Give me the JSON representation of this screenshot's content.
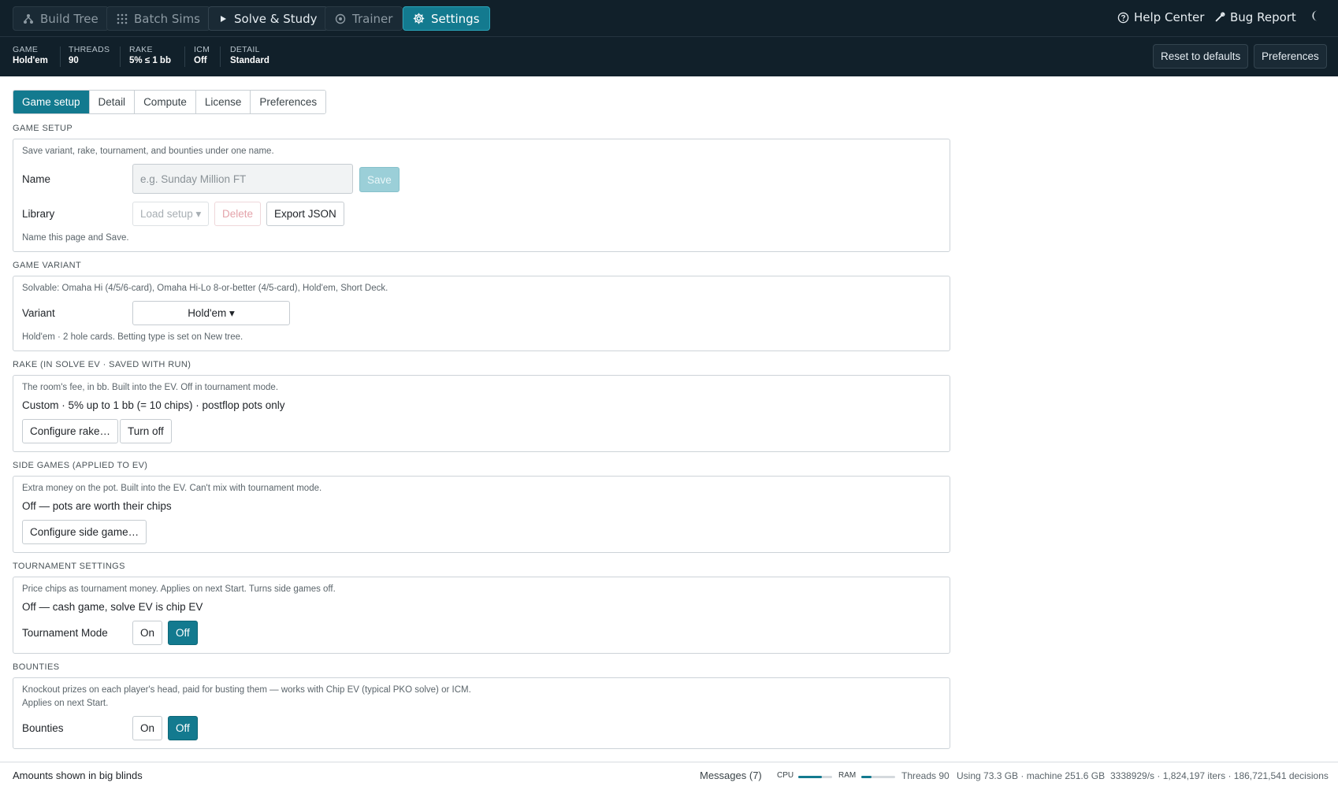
{
  "nav": {
    "build_tree": "Build Tree",
    "batch_sims": "Batch Sims",
    "solve_study": "Solve & Study",
    "trainer": "Trainer",
    "settings": "Settings",
    "help_center": "Help Center",
    "bug_report": "Bug Report",
    "theme_icon": "moon-icon"
  },
  "status": {
    "game_k": "GAME",
    "game_v": "Hold'em",
    "threads_k": "THREADS",
    "threads_v": "90",
    "rake_k": "RAKE",
    "rake_v": "5% ≤ 1 bb",
    "icm_k": "ICM",
    "icm_v": "Off",
    "detail_k": "DETAIL",
    "detail_v": "Standard",
    "reset": "Reset to defaults",
    "preferences": "Preferences"
  },
  "tabs": [
    "Game setup",
    "Detail",
    "Compute",
    "License",
    "Preferences"
  ],
  "game_setup": {
    "title": "GAME SETUP",
    "hint": "Save variant, rake, tournament, and bounties under one name.",
    "name_label": "Name",
    "name_placeholder": "e.g. Sunday Million FT",
    "save": "Save",
    "library_label": "Library",
    "load_setup": "Load setup ▾",
    "delete": "Delete",
    "export": "Export JSON",
    "footer_hint": "Name this page and Save."
  },
  "game_variant": {
    "title": "GAME VARIANT",
    "hint": "Solvable: Omaha Hi (4/5/6-card), Omaha Hi-Lo 8-or-better (4/5-card), Hold'em, Short Deck.",
    "variant_label": "Variant",
    "variant_value": "Hold'em ▾",
    "footer_hint": "Hold'em · 2 hole cards. Betting type is set on New tree."
  },
  "rake": {
    "title": "RAKE (IN SOLVE EV · SAVED WITH RUN)",
    "hint": "The room's fee, in bb. Built into the EV. Off in tournament mode.",
    "value": "Custom · 5% up to 1 bb (= 10 chips) · postflop pots only",
    "configure": "Configure rake…",
    "turn_off": "Turn off"
  },
  "side_games": {
    "title": "SIDE GAMES (APPLIED TO EV)",
    "hint": "Extra money on the pot. Built into the EV. Can't mix with tournament mode.",
    "value": "Off — pots are worth their chips",
    "configure": "Configure side game…"
  },
  "tournament": {
    "title": "TOURNAMENT SETTINGS",
    "hint": "Price chips as tournament money. Applies on next Start. Turns side games off.",
    "value": "Off — cash game, solve EV is chip EV",
    "mode_label": "Tournament Mode",
    "on": "On",
    "off": "Off"
  },
  "bounties": {
    "title": "BOUNTIES",
    "hint1": "Knockout prizes on each player's head, paid for busting them — works with Chip EV (typical PKO solve) or ICM.",
    "hint2": "Applies on next Start.",
    "label": "Bounties",
    "on": "On",
    "off": "Off"
  },
  "footer": {
    "amounts": "Amounts shown in big blinds",
    "messages": "Messages (7)",
    "cpu": "CPU",
    "cpu_level": 0.7,
    "ram": "RAM",
    "ram_level": 0.3,
    "threads": "Threads 90",
    "using": "Using 73.3 GB · machine 251.6 GB",
    "stats": "3338929/s · 1,824,197 iters · 186,721,541 decisions"
  },
  "colors": {
    "accent": "#137a8f",
    "topbar_bg": "#11202a"
  }
}
